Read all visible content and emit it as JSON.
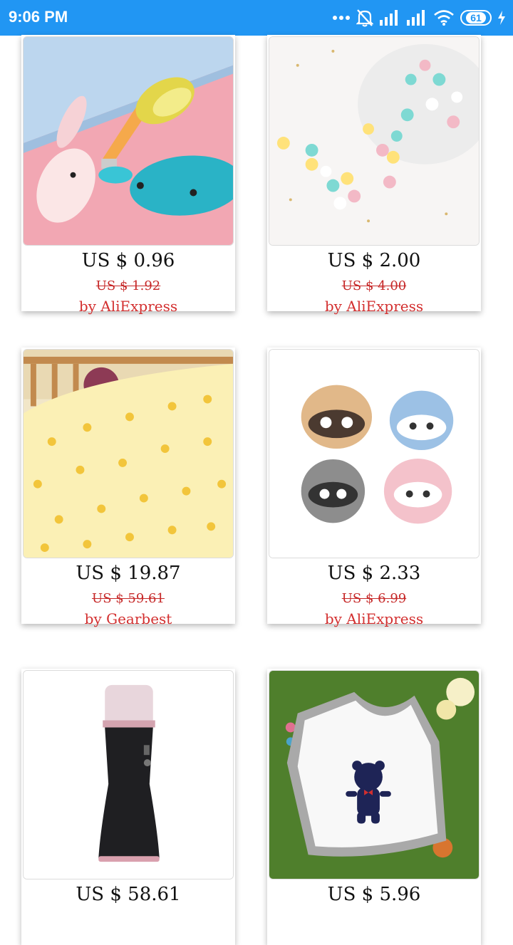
{
  "status_bar": {
    "time": "9:06 PM",
    "battery": "61",
    "icons": [
      "dots-icon",
      "bell-off-icon",
      "signal-icon",
      "signal-icon",
      "wifi-icon",
      "battery-icon",
      "charging-icon"
    ]
  },
  "products": [
    {
      "price": "US $ 0.96",
      "old_price": "US $ 1.92",
      "seller": "by AliExpress",
      "icon": "whale-nail-clipper"
    },
    {
      "price": "US $ 2.00",
      "old_price": "US $ 4.00",
      "seller": "by AliExpress",
      "icon": "silicone-beads"
    },
    {
      "price": "US $ 19.87",
      "old_price": "US $ 59.61",
      "seller": "by Gearbest",
      "icon": "pineapple-blanket"
    },
    {
      "price": "US $ 2.33",
      "old_price": "US $ 6.99",
      "seller": "by AliExpress",
      "icon": "raccoon-teethers"
    },
    {
      "price": "US $ 58.61",
      "old_price": "",
      "seller": "",
      "icon": "facial-mist-sprayer"
    },
    {
      "price": "US $ 5.96",
      "old_price": "",
      "seller": "",
      "icon": "bear-bib"
    }
  ],
  "colors": {
    "status_bar": "#2196f3",
    "old_price": "#c62828",
    "seller": "#d32f2f"
  }
}
